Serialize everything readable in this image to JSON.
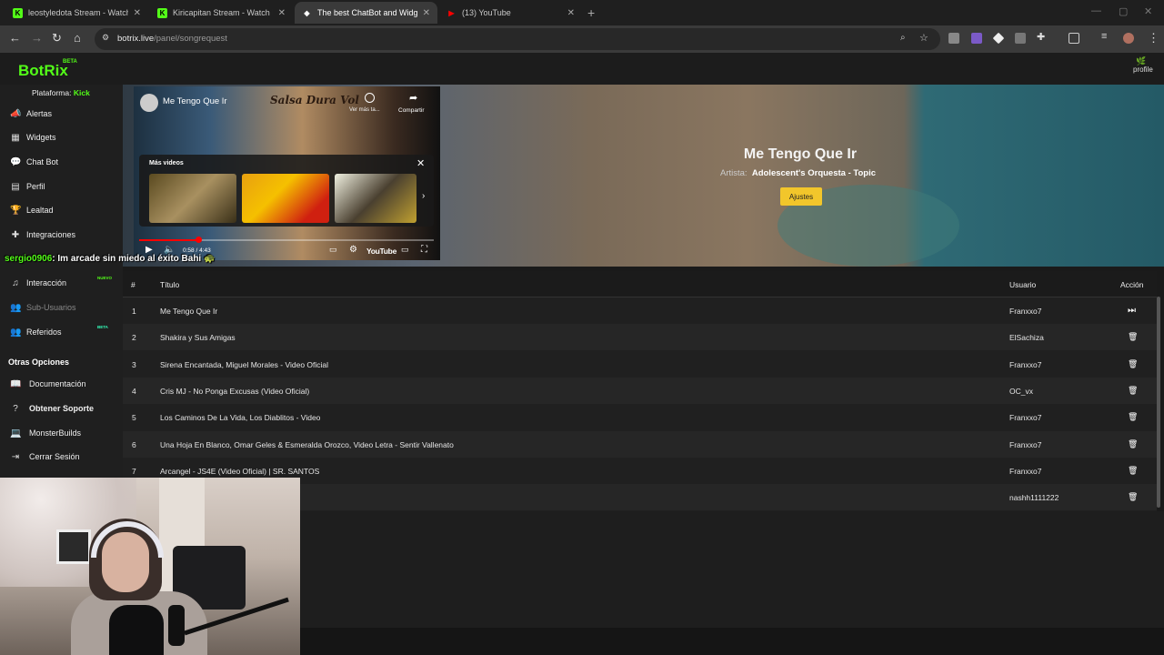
{
  "browser": {
    "tabs": [
      {
        "label": "leostyledota Stream - Watch Li",
        "favicon": "K",
        "favicon_color": "#53fc18",
        "active": false
      },
      {
        "label": "Kiricapitan Stream - Watch Live",
        "favicon": "K",
        "favicon_color": "#53fc18",
        "active": false
      },
      {
        "label": "The best ChatBot and Widgets",
        "favicon": "◆",
        "favicon_color": "#ffffff",
        "active": true
      },
      {
        "label": "(13) YouTube",
        "favicon": "▶",
        "favicon_color": "#ff0000",
        "active": false
      }
    ],
    "new_tab": "+",
    "url_host": "botrix.live",
    "url_path": "/panel/songrequest"
  },
  "app": {
    "logo": "BotRix",
    "beta": "BETA",
    "profile": "profile"
  },
  "sidebar": {
    "platform_label": "Plataforma:",
    "platform_value": "Kick",
    "items": [
      {
        "label": "Alertas",
        "icon": "megaphone-icon",
        "glyph": "📣"
      },
      {
        "label": "Widgets",
        "icon": "grid-icon",
        "glyph": "▦"
      },
      {
        "label": "Chat Bot",
        "icon": "chat-icon",
        "glyph": "💬"
      },
      {
        "label": "Perfil",
        "icon": "id-card-icon",
        "glyph": "▤"
      },
      {
        "label": "Lealtad",
        "icon": "trophy-icon",
        "glyph": "🏆"
      },
      {
        "label": "Integraciones",
        "icon": "puzzle-icon",
        "glyph": "✚"
      },
      {
        "label": "Interacción",
        "icon": "music-icon",
        "glyph": "♫",
        "badge": "NUEVO"
      },
      {
        "label": "Sub-Usuarios",
        "icon": "users-icon",
        "glyph": "👥",
        "disabled": true
      },
      {
        "label": "Referidos",
        "icon": "referral-icon",
        "glyph": "👥",
        "badge": "BETA"
      }
    ],
    "section_title": "Otras Opciones",
    "other_items": [
      {
        "label": "Documentación",
        "icon": "book-icon",
        "glyph": "📖"
      },
      {
        "label": "Obtener Soporte",
        "icon": "help-icon",
        "glyph": "?"
      },
      {
        "label": "MonsterBuilds",
        "icon": "laptop-icon",
        "glyph": "💻"
      },
      {
        "label": "Cerrar Sesión",
        "icon": "logout-icon",
        "glyph": "⇥"
      }
    ]
  },
  "player": {
    "video_title": "Me Tengo Que Ir",
    "channel_watermark": "Salsa Dura Vol",
    "watch_later": "Ver más ta...",
    "share": "Compartir",
    "more_videos": "Más videos",
    "time": "0:58 / 4:43",
    "progress": 0.2,
    "youtube": "YouTube"
  },
  "now_playing": {
    "title": "Me Tengo Que Ir",
    "artist_label": "Artista:",
    "artist": "Adolescent's Orquesta - Topic",
    "settings_button": "Ajustes"
  },
  "overlay": {
    "user": "sergio0906",
    "message": ": Im arcade sin miedo al éxito Bahi 🐢"
  },
  "queue": {
    "columns": {
      "num": "#",
      "title": "Título",
      "user": "Usuario",
      "action": "Acción"
    },
    "rows": [
      {
        "num": "1",
        "title": "Me Tengo Que Ir",
        "user": "Franxxo7",
        "action": "skip"
      },
      {
        "num": "2",
        "title": "Shakira y Sus Amigas",
        "user": "ElSachiza",
        "action": "delete"
      },
      {
        "num": "3",
        "title": "Sirena Encantada, Miguel Morales - Video Oficial",
        "user": "Franxxo7",
        "action": "delete"
      },
      {
        "num": "4",
        "title": "Cris MJ - No Ponga Excusas (Video Oficial)",
        "user": "OC_vx",
        "action": "delete"
      },
      {
        "num": "5",
        "title": "Los Caminos De La Vida, Los Diablitos - Video",
        "user": "Franxxo7",
        "action": "delete"
      },
      {
        "num": "6",
        "title": "Una Hoja En Blanco, Omar Geles & Esmeralda Orozco, Video Letra - Sentir Vallenato",
        "user": "Franxxo7",
        "action": "delete"
      },
      {
        "num": "7",
        "title": "Arcangel - JS4E (Video Oficial) | SR. SANTOS",
        "user": "Franxxo7",
        "action": "delete"
      },
      {
        "num": "",
        "title": "",
        "user": "nashh1111222",
        "action": "delete"
      }
    ]
  }
}
